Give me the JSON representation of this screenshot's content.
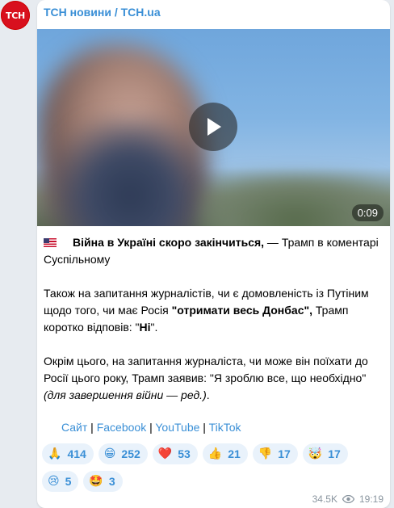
{
  "channel": {
    "avatar_text": "ТСН",
    "name": "ТСН новини / TCH.ua"
  },
  "video": {
    "duration": "0:09",
    "play_icon": "play-icon"
  },
  "message": {
    "flag_icon": "us-flag-icon",
    "p1_bold": "Війна в Україні скоро закінчиться,",
    "p1_rest": " — Трамп в коментарі Суспільному",
    "p2_a": "Також на запитання журналістів, чи є домовленість із Путіним щодо того, чи має Росія ",
    "p2_bold": "\"отримати весь Донбас\",",
    "p2_b": " Трамп коротко відповів: \"",
    "p2_bold2": "Ні",
    "p2_c": "\".",
    "p3_a": "Окрім цього, на запитання журналіста, чи може він поїхати до Росії цього року, Трамп заявив: \"Я зроблю все, що необхідно\" ",
    "p3_italic": "(для завершення війни — ред.)",
    "p3_end": "."
  },
  "links": {
    "site": "Сайт",
    "sep1": " | ",
    "facebook": "Facebook",
    "sep2": " | ",
    "youtube": "YouTube",
    "sep3": " | ",
    "tiktok": "TikTok"
  },
  "reactions": [
    {
      "emoji": "🙏",
      "count": "414",
      "icon": "pray-icon"
    },
    {
      "emoji": "😁",
      "count": "252",
      "icon": "grin-icon"
    },
    {
      "emoji": "❤️",
      "count": "53",
      "icon": "heart-icon"
    },
    {
      "emoji": "👍",
      "count": "21",
      "icon": "thumbs-up-icon"
    },
    {
      "emoji": "👎",
      "count": "17",
      "icon": "thumbs-down-icon"
    },
    {
      "emoji": "🤯",
      "count": "17",
      "icon": "mind-blown-icon"
    },
    {
      "emoji": "😢",
      "count": "5",
      "icon": "cry-icon"
    },
    {
      "emoji": "🤩",
      "count": "3",
      "icon": "star-struck-icon"
    }
  ],
  "footer": {
    "views": "34.5K",
    "time": "19:19"
  },
  "colors": {
    "accent": "#3a8fd6",
    "avatar": "#d8101e"
  }
}
